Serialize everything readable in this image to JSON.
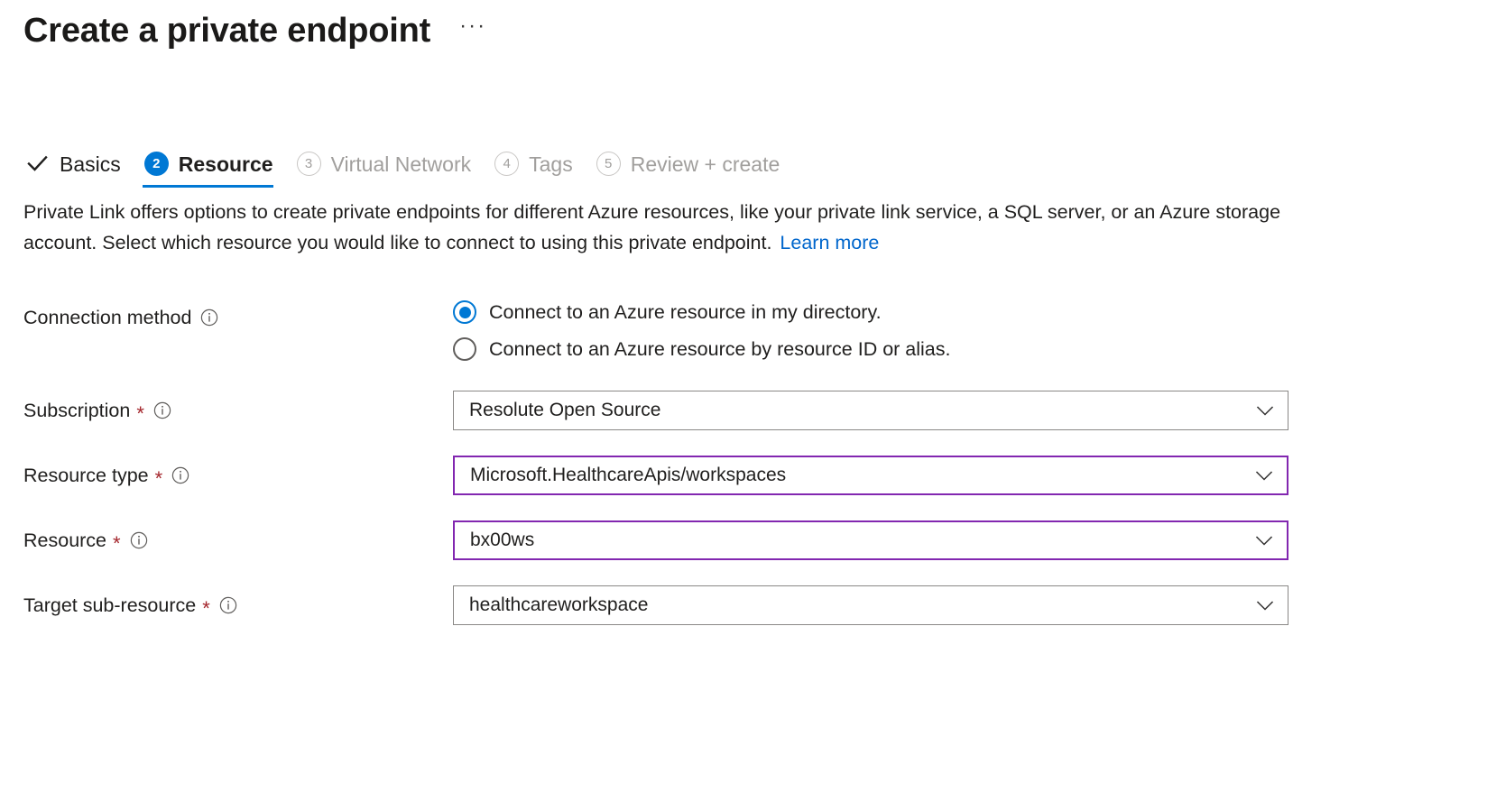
{
  "header": {
    "title": "Create a private endpoint",
    "more_label": "···"
  },
  "tabs": [
    {
      "label": "Basics",
      "marker": "✓",
      "state": "done"
    },
    {
      "label": "Resource",
      "marker": "2",
      "state": "active"
    },
    {
      "label": "Virtual Network",
      "marker": "3",
      "state": "pending"
    },
    {
      "label": "Tags",
      "marker": "4",
      "state": "pending"
    },
    {
      "label": "Review + create",
      "marker": "5",
      "state": "pending"
    }
  ],
  "description": {
    "text": "Private Link offers options to create private endpoints for different Azure resources, like your private link service, a SQL server, or an Azure storage account. Select which resource you would like to connect to using this private endpoint.",
    "link_label": "Learn more"
  },
  "form": {
    "connection_method": {
      "label": "Connection method",
      "options": [
        {
          "label": "Connect to an Azure resource in my directory.",
          "checked": true
        },
        {
          "label": "Connect to an Azure resource by resource ID or alias.",
          "checked": false
        }
      ]
    },
    "fields": [
      {
        "label": "Subscription",
        "required_marker": "*",
        "value": "Resolute Open Source",
        "highlighted": false
      },
      {
        "label": "Resource type",
        "required_marker": "*",
        "value": "Microsoft.HealthcareApis/workspaces",
        "highlighted": true
      },
      {
        "label": "Resource",
        "required_marker": "*",
        "value": "bx00ws",
        "highlighted": true
      },
      {
        "label": "Target sub-resource",
        "required_marker": "*",
        "value": "healthcareworkspace",
        "highlighted": false
      }
    ]
  },
  "colors": {
    "accent_blue": "#0078d4",
    "link_blue": "#0066cc",
    "required_red": "#a4262c",
    "highlight_purple": "#8227b0",
    "border_grey": "#8a8886",
    "disabled_grey": "#a19f9d"
  }
}
